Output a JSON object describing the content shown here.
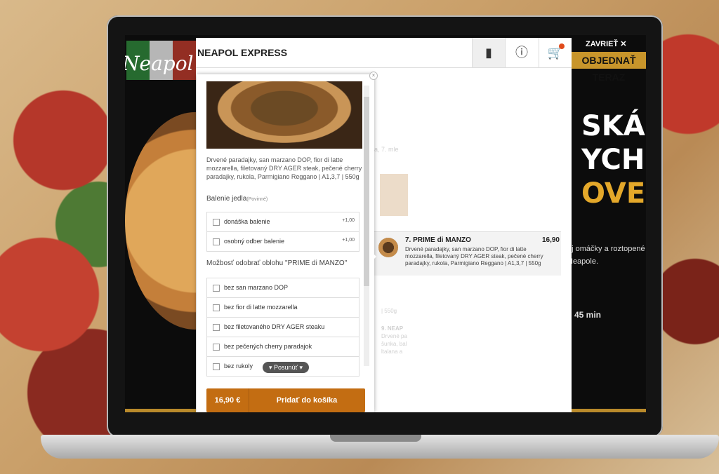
{
  "site": {
    "logo_text": "Neapol exp",
    "order_now": "OBJEDNAŤ TERAZ",
    "close": "ZAVRIEŤ ✕",
    "hero_lines": [
      "SKÁ",
      "YCH",
      "OVE."
    ],
    "hero_desc": "ej omáčky a roztopené v Neapole.",
    "timer": "45 min"
  },
  "modal": {
    "title": "NEAPOL EXPRESS",
    "buttons": {
      "menu_icon": "map-icon",
      "info_icon": "info-icon",
      "cart_icon": "cart-icon"
    },
    "cart_badge": "1"
  },
  "list": {
    "faded_text": "ja, 7. mle",
    "highlighted": {
      "name": "7. PRIME di MANZO",
      "price": "16,90",
      "desc": "Drvené paradajky, san marzano DOP, fior di latte mozzarella, filetovaný DRY AGER steak, pečené cherry paradajky, rukola, Parmigiano Reggano | A1,3,7 | 550g"
    },
    "faded_items": [
      "| 550g",
      "9. NEAP",
      "Drvené pa",
      "šunka, bal",
      "ltalana a"
    ]
  },
  "popover": {
    "description": "Drvené paradajky, san marzano DOP, fior di latte mozzarella, filetovaný DRY AGER steak, pečené cherry paradajky, rukola, Parmigiano Reggano | A1,3,7 | 550g",
    "packaging_title": "Balenie jedla",
    "packaging_required": "(Povinné)",
    "packaging_options": [
      {
        "label": "donáška balenie",
        "price": "+1,00"
      },
      {
        "label": "osobný odber balenie",
        "price": "+1,00"
      }
    ],
    "removal_title": "Možbosť odobrať oblohu \"PRIME di MANZO\"",
    "removal_options": [
      {
        "label": "bez san marzano DOP"
      },
      {
        "label": "bez fior di latte mozzarella"
      },
      {
        "label": "bez filetovaného DRY AGER steaku"
      },
      {
        "label": "bez pečených cherry paradajok"
      },
      {
        "label": "bez rukoly"
      }
    ],
    "scroll_hint": "Posunúť",
    "add_price": "16,90 €",
    "add_label": "Pridať do košíka"
  }
}
